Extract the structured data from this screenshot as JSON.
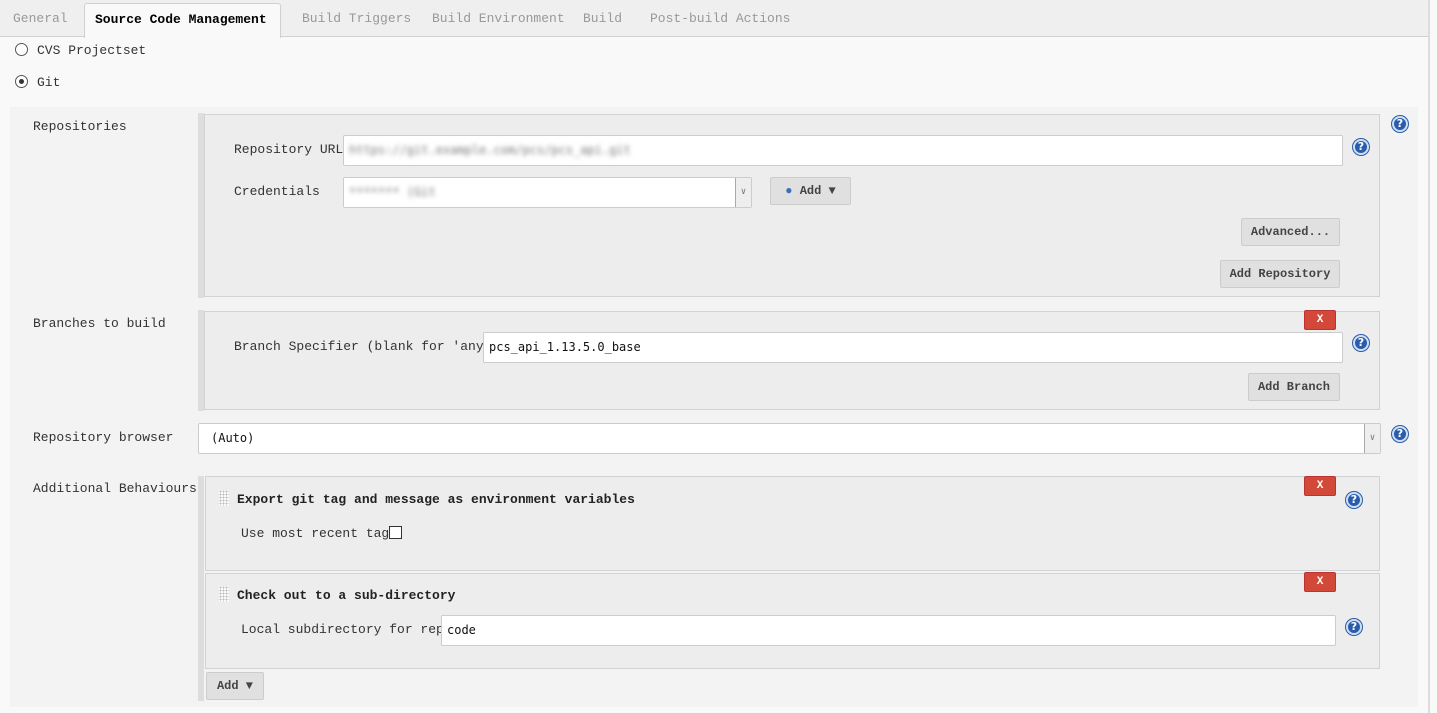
{
  "tabs": [
    {
      "label": "General",
      "active": false
    },
    {
      "label": "Source Code Management",
      "active": true
    },
    {
      "label": "Build Triggers",
      "active": false
    },
    {
      "label": "Build Environment",
      "active": false
    },
    {
      "label": "Build",
      "active": false
    },
    {
      "label": "Post-build Actions",
      "active": false
    }
  ],
  "scm": {
    "options": [
      {
        "label": "CVS Projectset",
        "selected": false
      },
      {
        "label": "Git",
        "selected": true
      }
    ],
    "repositories": {
      "label": "Repositories",
      "url_label": "Repository URL",
      "url_value": "https://git.example.com/pcs/pcs_api.git",
      "credentials_label": "Credentials",
      "credentials_value": "******* (Git",
      "add_label": "Add",
      "advanced_label": "Advanced...",
      "add_repository_label": "Add Repository"
    },
    "branches": {
      "label": "Branches to build",
      "specifier_label": "Branch Specifier (blank for 'any')",
      "specifier_value": "pcs_api_1.13.5.0_base",
      "delete_label": "X",
      "add_branch_label": "Add Branch"
    },
    "browser": {
      "label": "Repository browser",
      "value": "(Auto)"
    },
    "behaviours": {
      "label": "Additional Behaviours",
      "items": [
        {
          "title": "Export git tag and message as environment variables",
          "field_label": "Use most recent tag",
          "checked": false,
          "delete_label": "X"
        },
        {
          "title": "Check out to a sub-directory",
          "field_label": "Local subdirectory for repo",
          "field_value": "code",
          "delete_label": "X"
        }
      ],
      "add_label": "Add"
    }
  },
  "help_label": "?",
  "colors": {
    "delete": "#d24939",
    "help": "#2a5caa"
  }
}
